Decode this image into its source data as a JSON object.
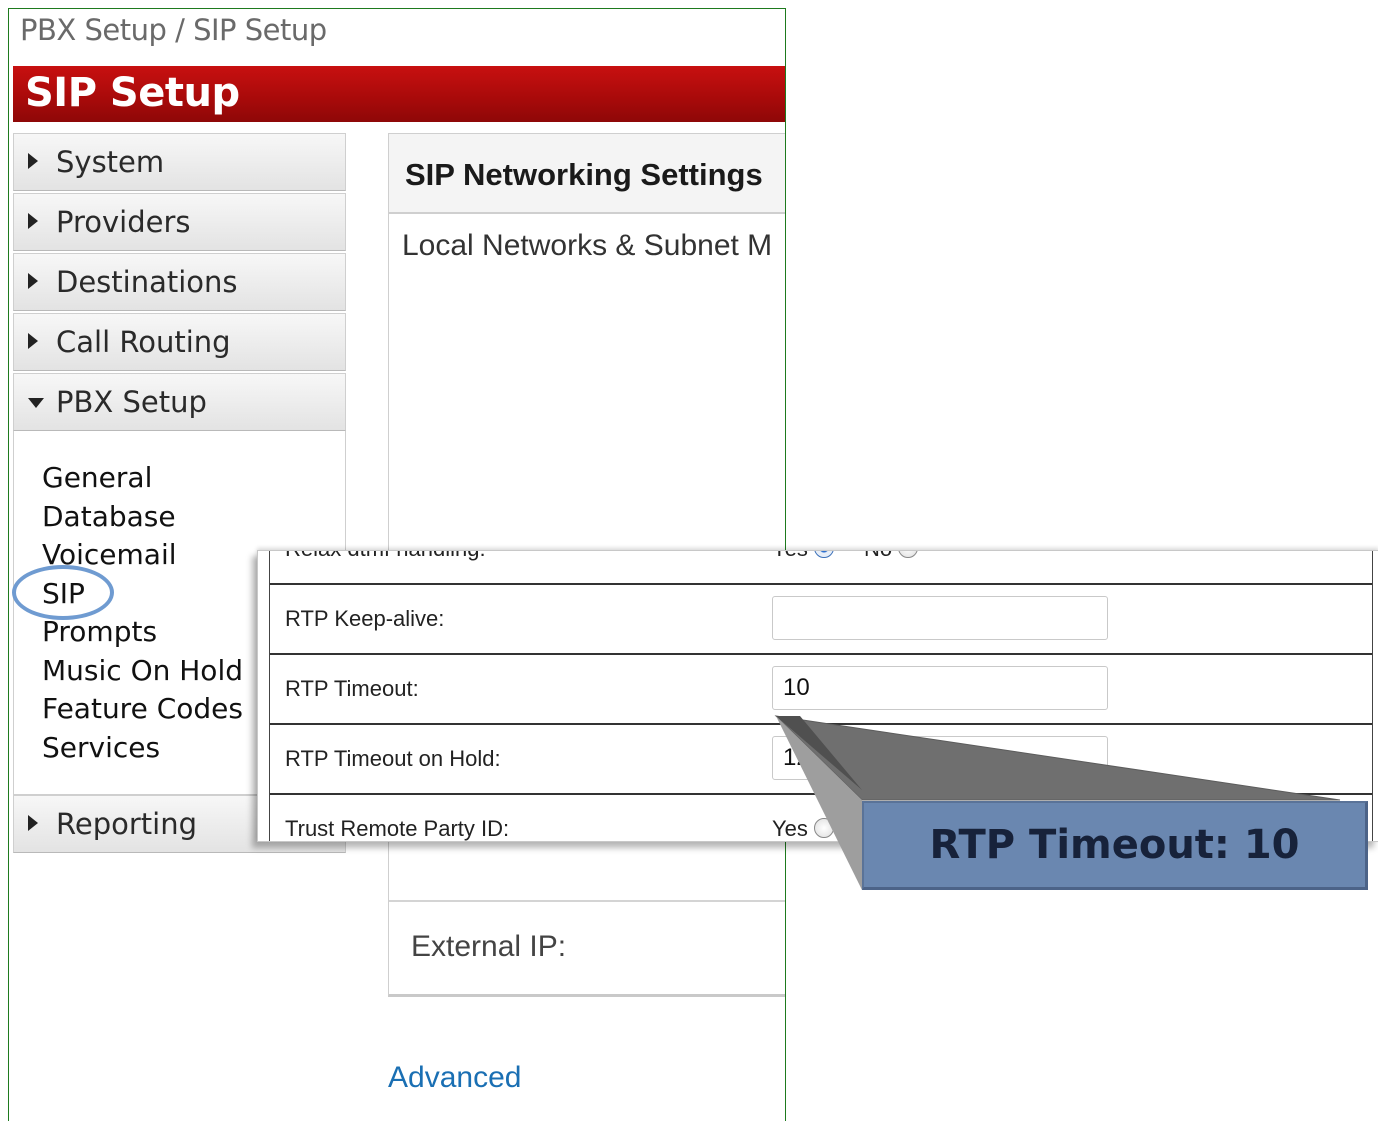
{
  "breadcrumb": "PBX Setup / SIP Setup",
  "page_title": "SIP Setup",
  "sidebar": {
    "sections": [
      {
        "label": "System",
        "expanded": false
      },
      {
        "label": "Providers",
        "expanded": false
      },
      {
        "label": "Destinations",
        "expanded": false
      },
      {
        "label": "Call Routing",
        "expanded": false
      },
      {
        "label": "PBX Setup",
        "expanded": true
      }
    ],
    "submenu": [
      "General",
      "Database",
      "Voicemail",
      "SIP",
      "Prompts",
      "Music On Hold",
      "Feature Codes",
      "Services"
    ],
    "reporting": {
      "label": "Reporting",
      "expanded": false
    }
  },
  "content": {
    "panel_title": "SIP Networking Settings",
    "local_networks_label": "Local Networks & Subnet M",
    "external_ip_label": "External IP:",
    "advanced_link": "Advanced"
  },
  "zoom": {
    "relax_dtmf": {
      "label": "Relax dtmf handling:",
      "yes": "Yes",
      "no": "No"
    },
    "rtp_keepalive": {
      "label": "RTP Keep-alive:",
      "value": ""
    },
    "rtp_timeout": {
      "label": "RTP Timeout:",
      "value": "10"
    },
    "rtp_timeout_hold": {
      "label": "RTP Timeout on Hold:",
      "value": "12"
    },
    "trust_remote_party": {
      "label": "Trust Remote Party ID:",
      "yes": "Yes"
    }
  },
  "callout": {
    "text": "RTP Timeout: 10"
  },
  "colors": {
    "title_bar": "#b20c0c",
    "callout_fill": "#6a87b0",
    "highlight_circle": "#6f9bd1",
    "link": "#1a6fb3",
    "frame": "#1e7a1e"
  }
}
